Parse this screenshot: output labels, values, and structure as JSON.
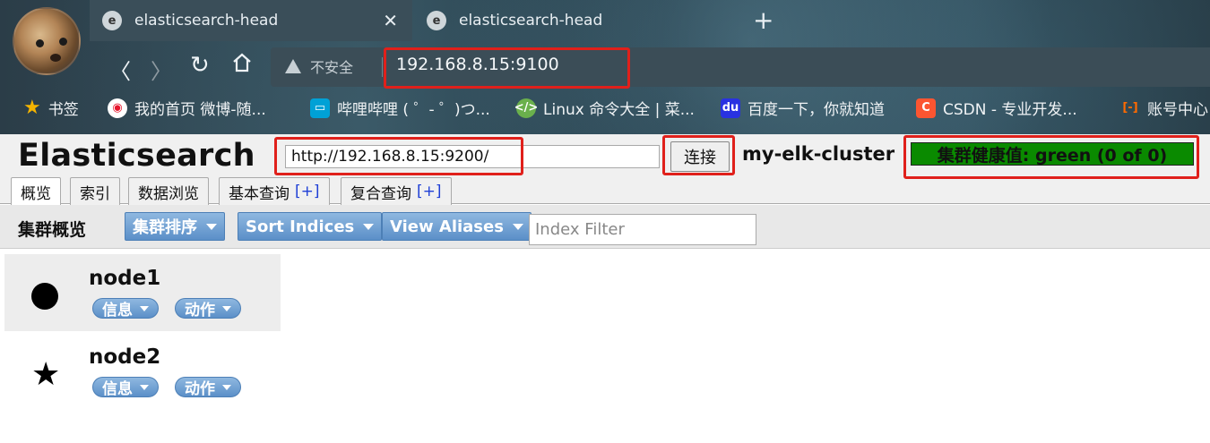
{
  "browser": {
    "tabs": [
      {
        "title": "elasticsearch-head",
        "active": true
      },
      {
        "title": "elasticsearch-head",
        "active": false
      }
    ],
    "new_tab_icon": "plus-icon",
    "security_label": "不安全",
    "url": "192.168.8.15:9100",
    "bookmarks": [
      {
        "label": "书签",
        "icon": "star-icon",
        "color": "#f5b400"
      },
      {
        "label": "我的首页 微博-随...",
        "icon": "weibo-icon",
        "color": "#e6162d"
      },
      {
        "label": "哔哩哔哩 ( ゜- ゜)つ...",
        "icon": "bilibili-icon",
        "color": "#00a1d6"
      },
      {
        "label": "Linux 命令大全 | 菜...",
        "icon": "runoob-icon",
        "color": "#6ab04c"
      },
      {
        "label": "百度一下，你就知道",
        "icon": "baidu-icon",
        "color": "#2932e1"
      },
      {
        "label": "CSDN - 专业开发...",
        "icon": "csdn-icon",
        "color": "#fc5531"
      },
      {
        "label": "账号中心",
        "icon": "aliyun-icon",
        "color": "#ff6a00"
      }
    ]
  },
  "header": {
    "brand": "Elasticsearch",
    "connect_url": "http://192.168.8.15:9200/",
    "connect_label": "连接",
    "cluster_name": "my-elk-cluster",
    "health": "集群健康值: green (0 of 0)",
    "health_color": "#0a8a00"
  },
  "tabs": [
    {
      "label": "概览",
      "plus": ""
    },
    {
      "label": "索引",
      "plus": ""
    },
    {
      "label": "数据浏览",
      "plus": ""
    },
    {
      "label": "基本查询",
      "plus": "[+]"
    },
    {
      "label": "复合查询",
      "plus": "[+]"
    }
  ],
  "toolbar": {
    "title": "集群概览",
    "sort_cluster": "集群排序",
    "sort_indices": "Sort Indices",
    "view_aliases": "View Aliases",
    "index_filter_placeholder": "Index Filter"
  },
  "nodes": [
    {
      "name": "node1",
      "marker": "circle",
      "info_label": "信息",
      "action_label": "动作"
    },
    {
      "name": "node2",
      "marker": "star",
      "info_label": "信息",
      "action_label": "动作"
    }
  ]
}
